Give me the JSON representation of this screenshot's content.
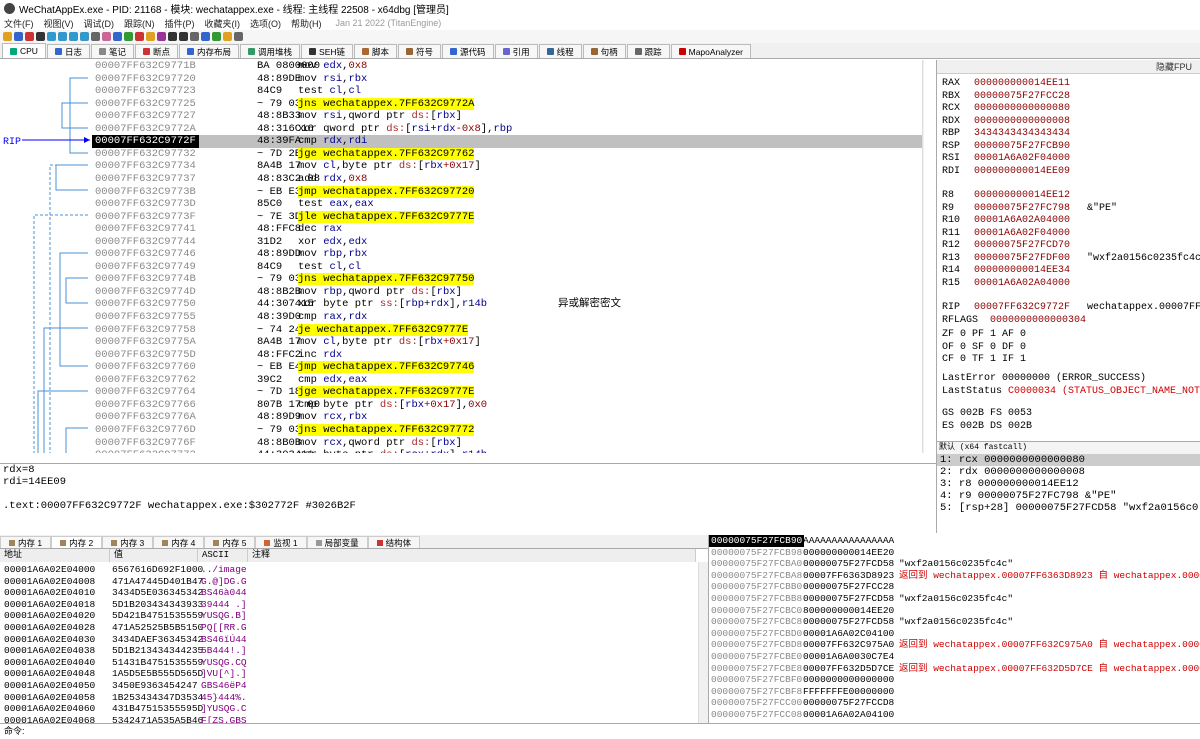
{
  "title": "WeChatAppEx.exe - PID: 21168 - 模块: wechatappex.exe - 线程: 主线程 22508 - x64dbg [管理员]",
  "menu": [
    "文件(F)",
    "视图(V)",
    "调试(D)",
    "跟踪(N)",
    "插件(P)",
    "收藏夹(I)",
    "选项(O)",
    "帮助(H)"
  ],
  "menu_info": "Jan 21 2022 (TitanEngine)",
  "tabs": [
    "CPU",
    "日志",
    "笔记",
    "断点",
    "内存布局",
    "调用堆栈",
    "SEH链",
    "脚本",
    "符号",
    "源代码",
    "引用",
    "线程",
    "句柄",
    "跟踪",
    "MapoAnalyzer"
  ],
  "rip_label": "RIP",
  "disasm": [
    {
      "addr": "00007FF632C9771B",
      "bytes": "BA 0800000",
      "instr": [
        [
          "mov ",
          "k"
        ],
        [
          "edx",
          "r"
        ],
        [
          ",",
          "k"
        ],
        [
          "0x8",
          "n"
        ]
      ]
    },
    {
      "addr": "00007FF632C97720",
      "bytes": "48:89DE",
      "instr": [
        [
          "mov ",
          "k"
        ],
        [
          "rsi",
          "r"
        ],
        [
          ",",
          "k"
        ],
        [
          "rbx",
          "r"
        ]
      ]
    },
    {
      "addr": "00007FF632C97723",
      "bytes": "84C9",
      "instr": [
        [
          "test ",
          "k"
        ],
        [
          "cl",
          "r"
        ],
        [
          ",",
          "k"
        ],
        [
          "cl",
          "r"
        ]
      ]
    },
    {
      "addr": "00007FF632C97725",
      "bytes": "~ 79 03",
      "instr": [
        [
          "jns wechatappex.7FF632C9772A",
          "j"
        ]
      ]
    },
    {
      "addr": "00007FF632C97727",
      "bytes": "48:8B33",
      "instr": [
        [
          "mov ",
          "k"
        ],
        [
          "rsi",
          "r"
        ],
        [
          ",qword ptr ",
          "k"
        ],
        [
          "ds:",
          "seg"
        ],
        [
          "[",
          "k"
        ],
        [
          "rbx",
          "r"
        ],
        [
          "]",
          "k"
        ]
      ]
    },
    {
      "addr": "00007FF632C9772A",
      "bytes": "48:316C16",
      "instr": [
        [
          "xor qword ptr ",
          "k"
        ],
        [
          "ds:",
          "seg"
        ],
        [
          "[",
          "k"
        ],
        [
          "rsi",
          "r"
        ],
        [
          "+",
          "k"
        ],
        [
          "rdx",
          "r"
        ],
        [
          "-0x8",
          "n"
        ],
        [
          "],",
          "k"
        ],
        [
          "rbp",
          "r"
        ]
      ]
    },
    {
      "addr": "00007FF632C9772F",
      "bytes": "48:39FA",
      "instr": [
        [
          "cmp ",
          "k"
        ],
        [
          "rdx",
          "r"
        ],
        [
          ",",
          "k"
        ],
        [
          "rdi",
          "r"
        ]
      ],
      "sel": true
    },
    {
      "addr": "00007FF632C97732",
      "bytes": "~ 7D 2E",
      "instr": [
        [
          "jge wechatappex.7FF632C97762",
          "j"
        ]
      ]
    },
    {
      "addr": "00007FF632C97734",
      "bytes": "8A4B 17",
      "instr": [
        [
          "mov ",
          "k"
        ],
        [
          "cl",
          "r"
        ],
        [
          ",byte ptr ",
          "k"
        ],
        [
          "ds:",
          "seg"
        ],
        [
          "[",
          "k"
        ],
        [
          "rbx",
          "r"
        ],
        [
          "+0x17",
          "n"
        ],
        [
          "]",
          "k"
        ]
      ]
    },
    {
      "addr": "00007FF632C97737",
      "bytes": "48:83C2 08",
      "instr": [
        [
          "add ",
          "k"
        ],
        [
          "rdx",
          "r"
        ],
        [
          ",",
          "k"
        ],
        [
          "0x8",
          "n"
        ]
      ]
    },
    {
      "addr": "00007FF632C9773B",
      "bytes": "~ EB E3",
      "instr": [
        [
          "jmp wechatappex.7FF632C97720",
          "j"
        ]
      ]
    },
    {
      "addr": "00007FF632C9773D",
      "bytes": "85C0",
      "instr": [
        [
          "test ",
          "k"
        ],
        [
          "eax",
          "r"
        ],
        [
          ",",
          "k"
        ],
        [
          "eax",
          "r"
        ]
      ]
    },
    {
      "addr": "00007FF632C9773F",
      "bytes": "~ 7E 3D",
      "instr": [
        [
          "jle wechatappex.7FF632C9777E",
          "j"
        ]
      ]
    },
    {
      "addr": "00007FF632C97741",
      "bytes": "48:FFC8",
      "instr": [
        [
          "dec ",
          "k"
        ],
        [
          "rax",
          "r"
        ]
      ]
    },
    {
      "addr": "00007FF632C97744",
      "bytes": "31D2",
      "instr": [
        [
          "xor ",
          "k"
        ],
        [
          "edx",
          "r"
        ],
        [
          ",",
          "k"
        ],
        [
          "edx",
          "r"
        ]
      ]
    },
    {
      "addr": "00007FF632C97746",
      "bytes": "48:89DD",
      "instr": [
        [
          "mov ",
          "k"
        ],
        [
          "rbp",
          "r"
        ],
        [
          ",",
          "k"
        ],
        [
          "rbx",
          "r"
        ]
      ]
    },
    {
      "addr": "00007FF632C97749",
      "bytes": "84C9",
      "instr": [
        [
          "test ",
          "k"
        ],
        [
          "cl",
          "r"
        ],
        [
          ",",
          "k"
        ],
        [
          "cl",
          "r"
        ]
      ]
    },
    {
      "addr": "00007FF632C9774B",
      "bytes": "~ 79 03",
      "instr": [
        [
          "jns wechatappex.7FF632C97750",
          "j"
        ]
      ]
    },
    {
      "addr": "00007FF632C9774D",
      "bytes": "48:8B2B",
      "instr": [
        [
          "mov ",
          "k"
        ],
        [
          "rbp",
          "r"
        ],
        [
          ",qword ptr ",
          "k"
        ],
        [
          "ds:",
          "seg"
        ],
        [
          "[",
          "k"
        ],
        [
          "rbx",
          "r"
        ],
        [
          "]",
          "k"
        ]
      ]
    },
    {
      "addr": "00007FF632C97750",
      "bytes": "44:307415",
      "instr": [
        [
          "xor byte ptr ",
          "k"
        ],
        [
          "ss:",
          "seg"
        ],
        [
          "[",
          "k"
        ],
        [
          "rbp",
          "r"
        ],
        [
          "+",
          "k"
        ],
        [
          "rdx",
          "r"
        ],
        [
          "]",
          "k"
        ],
        [
          ",",
          "k"
        ],
        [
          "r14b",
          "r"
        ]
      ],
      "cmt": "异或解密密文"
    },
    {
      "addr": "00007FF632C97755",
      "bytes": "48:39D0",
      "instr": [
        [
          "cmp ",
          "k"
        ],
        [
          "rax",
          "r"
        ],
        [
          ",",
          "k"
        ],
        [
          "rdx",
          "r"
        ]
      ]
    },
    {
      "addr": "00007FF632C97758",
      "bytes": "~ 74 24",
      "instr": [
        [
          "je wechatappex.7FF632C9777E",
          "j"
        ]
      ]
    },
    {
      "addr": "00007FF632C9775A",
      "bytes": "8A4B 17",
      "instr": [
        [
          "mov ",
          "k"
        ],
        [
          "cl",
          "r"
        ],
        [
          ",byte ptr ",
          "k"
        ],
        [
          "ds:",
          "seg"
        ],
        [
          "[",
          "k"
        ],
        [
          "rbx",
          "r"
        ],
        [
          "+0x17",
          "n"
        ],
        [
          "]",
          "k"
        ]
      ]
    },
    {
      "addr": "00007FF632C9775D",
      "bytes": "48:FFC2",
      "instr": [
        [
          "inc ",
          "k"
        ],
        [
          "rdx",
          "r"
        ]
      ]
    },
    {
      "addr": "00007FF632C97760",
      "bytes": "~ EB E4",
      "instr": [
        [
          "jmp wechatappex.7FF632C97746",
          "j"
        ]
      ]
    },
    {
      "addr": "00007FF632C97762",
      "bytes": "39C2",
      "instr": [
        [
          "cmp ",
          "k"
        ],
        [
          "edx",
          "r"
        ],
        [
          ",",
          "k"
        ],
        [
          "eax",
          "r"
        ]
      ]
    },
    {
      "addr": "00007FF632C97764",
      "bytes": "~ 7D 18",
      "instr": [
        [
          "jge wechatappex.7FF632C9777E",
          "j"
        ]
      ]
    },
    {
      "addr": "00007FF632C97766",
      "bytes": "807B 17 00",
      "instr": [
        [
          "cmp byte ptr ",
          "k"
        ],
        [
          "ds:",
          "seg"
        ],
        [
          "[",
          "k"
        ],
        [
          "rbx",
          "r"
        ],
        [
          "+0x17",
          "n"
        ],
        [
          "],",
          "k"
        ],
        [
          "0x0",
          "n"
        ]
      ]
    },
    {
      "addr": "00007FF632C9776A",
      "bytes": "48:89D9",
      "instr": [
        [
          "mov ",
          "k"
        ],
        [
          "rcx",
          "r"
        ],
        [
          ",",
          "k"
        ],
        [
          "rbx",
          "r"
        ]
      ]
    },
    {
      "addr": "00007FF632C9776D",
      "bytes": "~ 79 03",
      "instr": [
        [
          "jns wechatappex.7FF632C97772",
          "j"
        ]
      ]
    },
    {
      "addr": "00007FF632C9776F",
      "bytes": "48:8B0B",
      "instr": [
        [
          "mov ",
          "k"
        ],
        [
          "rcx",
          "r"
        ],
        [
          ",qword ptr ",
          "k"
        ],
        [
          "ds:",
          "seg"
        ],
        [
          "[",
          "k"
        ],
        [
          "rbx",
          "r"
        ],
        [
          "]",
          "k"
        ]
      ]
    },
    {
      "addr": "00007FF632C97772",
      "bytes": "44:303411",
      "instr": [
        [
          "xor byte ptr ",
          "k"
        ],
        [
          "ds:",
          "seg"
        ],
        [
          "[",
          "k"
        ],
        [
          "rcx",
          "r"
        ],
        [
          "+",
          "k"
        ],
        [
          "rdx",
          "r"
        ],
        [
          "],",
          "k"
        ],
        [
          "r14b",
          "r"
        ]
      ]
    }
  ],
  "regs_header": "隐藏FPU",
  "regs": [
    {
      "n": "RAX",
      "v": "000000000014EE11"
    },
    {
      "n": "RBX",
      "v": "00000075F27FCC28"
    },
    {
      "n": "RCX",
      "v": "0000000000000080"
    },
    {
      "n": "RDX",
      "v": "0000000000000008"
    },
    {
      "n": "RBP",
      "v": "3434343434343434"
    },
    {
      "n": "RSP",
      "v": "00000075F27FCB90"
    },
    {
      "n": "RSI",
      "v": "00001A6A02F04000"
    },
    {
      "n": "RDI",
      "v": "000000000014EE09"
    },
    {
      "n": "R8",
      "v": "000000000014EE12"
    },
    {
      "n": "R9",
      "v": "00000075F27FC798",
      "e": "&\"PE\""
    },
    {
      "n": "R10",
      "v": "00001A6A02A04000"
    },
    {
      "n": "R11",
      "v": "00001A6A02F04000"
    },
    {
      "n": "R12",
      "v": "00000075F27FCD70"
    },
    {
      "n": "R13",
      "v": "00000075F27FDF00",
      "e": "\"wxf2a0156c0235fc4c\""
    },
    {
      "n": "R14",
      "v": "000000000014EE34"
    },
    {
      "n": "R15",
      "v": "00001A6A02A04000"
    },
    {
      "n": "RIP",
      "v": "00007FF632C9772F",
      "e": "wechatappex.00007FF63"
    }
  ],
  "rflags": {
    "label": "RFLAGS",
    "value": "0000000000000304"
  },
  "flags": [
    "ZF 0  PF 1  AF 0",
    "OF 0  SF 0  DF 0",
    "CF 0  TF 1  IF 1"
  ],
  "lasterror": {
    "label": "LastError",
    "value": "00000000 (ERROR_SUCCESS)"
  },
  "laststatus": {
    "label": "LastStatus",
    "value": "C0000034 (STATUS_OBJECT_NAME_NOT_FOUN"
  },
  "segs": [
    "GS 002B  FS 0053",
    "ES 002B  DS 002B"
  ],
  "args_header": "默认 (x64 fastcall)",
  "args": [
    "1: rcx 0000000000000080",
    "2: rdx 0000000000000008",
    "3: r8 000000000014EE12",
    "4: r9 00000075F27FC798 &\"PE\"",
    "5: [rsp+28] 00000075F27FCD58 \"wxf2a0156c0"
  ],
  "info": [
    "rdx=8",
    "rdi=14EE09",
    "",
    ".text:00007FF632C9772F wechatappex.exe:$302772F #3026B2F"
  ],
  "bottom_tabs": [
    "内存 1",
    "内存 2",
    "内存 3",
    "内存 4",
    "内存 5",
    "监视 1",
    "局部变量",
    "结构体"
  ],
  "dump_headers": [
    "地址",
    "值",
    "ASCII",
    "注释"
  ],
  "dump": [
    [
      "00001A6A02E04000",
      "6567616D692F1000",
      "../image"
    ],
    [
      "00001A6A02E04008",
      "471A47445D401B47",
      "G.@]DG.G"
    ],
    [
      "00001A6A02E04010",
      "3434D5E036345342",
      "BS46à044"
    ],
    [
      "00001A6A02E04018",
      "5D1B203434343933",
      "39444 .]"
    ],
    [
      "00001A6A02E04020",
      "5D421B4751535559",
      "YUSQG.B]"
    ],
    [
      "00001A6A02E04028",
      "471A52525B5B5150",
      "PQ[[RR.G"
    ],
    [
      "00001A6A02E04030",
      "3434DAEF36345342",
      "BS46ïÚ44"
    ],
    [
      "00001A6A02E04038",
      "5D1B213434344235",
      "5B444!.]"
    ],
    [
      "00001A6A02E04040",
      "51431B4751535559",
      "YUSQG.CQ"
    ],
    [
      "00001A6A02E04048",
      "1A5D5E5B555D565D",
      "]VU[^].]"
    ],
    [
      "00001A6A02E04050",
      "3450E9363454247",
      "GBS46ëP4"
    ],
    [
      "00001A6A02E04058",
      "1B253434347D3534",
      "45}444%."
    ],
    [
      "00001A6A02E04060",
      "431B47515355595D",
      "]YUSQG.C"
    ],
    [
      "00001A6A02E04068",
      "5342471A535A5B46",
      "F[ZS.GBS"
    ]
  ],
  "stack_top": {
    "addr": "00000075F27FCB90",
    "val": "AAAAAAAAAAAAAAAA"
  },
  "stack": [
    {
      "a": "00000075F27FCB98",
      "v": "000000000014EE20",
      "c": ""
    },
    {
      "a": "00000075F27FCBA0",
      "v": "00000075F27FCD58",
      "c": "\"wxf2a0156c0235fc4c\""
    },
    {
      "a": "00000075F27FCBA8",
      "v": "00007FF6363D8923",
      "c": "返回到 wechatappex.00007FF6363D8923 自 wechatappex.00007F",
      "r": true
    },
    {
      "a": "00000075F27FCBB0",
      "v": "00000075F27FCC28",
      "c": ""
    },
    {
      "a": "00000075F27FCBB8",
      "v": "00000075F27FCD58",
      "c": "\"wxf2a0156c0235fc4c\""
    },
    {
      "a": "00000075F27FCBC0",
      "v": "800000000014EE20",
      "c": ""
    },
    {
      "a": "00000075F27FCBC8",
      "v": "00000075F27FCD58",
      "c": "\"wxf2a0156c0235fc4c\""
    },
    {
      "a": "00000075F27FCBD0",
      "v": "00001A6A02C04100",
      "c": ""
    },
    {
      "a": "00000075F27FCBD8",
      "v": "00007FF632C975A0",
      "c": "返回到 wechatappex.00007FF632C975A0 自 wechatappex.00007F",
      "r": true
    },
    {
      "a": "00000075F27FCBE0",
      "v": "00001A6A0030C7E4",
      "c": ""
    },
    {
      "a": "00000075F27FCBE8",
      "v": "00007FF632D5D7CE",
      "c": "返回到 wechatappex.00007FF632D5D7CE 自 wechatappex.00007F",
      "r": true
    },
    {
      "a": "00000075F27FCBF0",
      "v": "0000000000000000",
      "c": ""
    },
    {
      "a": "00000075F27FCBF8",
      "v": "FFFFFFFE00000000",
      "c": ""
    },
    {
      "a": "00000075F27FCC00",
      "v": "00000075F27FCCD8",
      "c": ""
    },
    {
      "a": "00000075F27FCC08",
      "v": "00001A6A02A04100",
      "c": ""
    }
  ],
  "command_label": "命令:"
}
